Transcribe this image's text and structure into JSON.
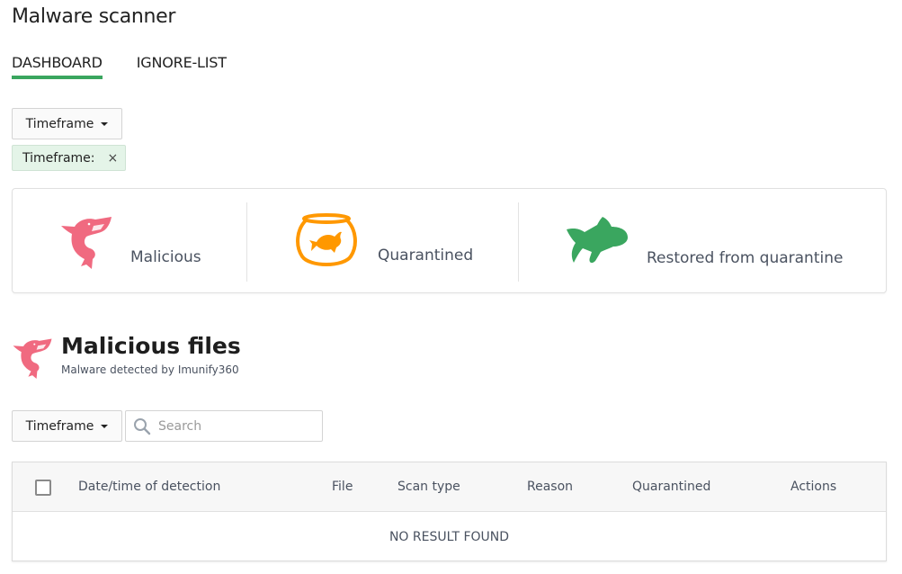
{
  "page": {
    "title": "Malware scanner"
  },
  "tabs": [
    {
      "label": "DASHBOARD",
      "active": true
    },
    {
      "label": "IGNORE-LIST",
      "active": false
    }
  ],
  "filters": {
    "timeframe_button": "Timeframe",
    "active_chip": {
      "label": "Timeframe:",
      "close_icon": "×"
    }
  },
  "stats": [
    {
      "label": "Malicious",
      "icon": "shark-icon",
      "color": "#f06a80"
    },
    {
      "label": "Quarantined",
      "icon": "fishbowl-icon",
      "color": "#ff9800"
    },
    {
      "label": "Restored from quarantine",
      "icon": "fish-icon",
      "color": "#3aa65f"
    }
  ],
  "section": {
    "title": "Malicious files",
    "subtitle": "Malware detected by Imunify360",
    "icon": "shark-icon"
  },
  "toolbar": {
    "timeframe_button": "Timeframe",
    "search_placeholder": "Search",
    "search_value": ""
  },
  "table": {
    "columns": [
      "Date/time of detection",
      "File",
      "Scan type",
      "Reason",
      "Quarantined",
      "Actions"
    ],
    "rows": [],
    "empty_message": "NO RESULT FOUND"
  },
  "colors": {
    "accent": "#3aa65f",
    "malicious": "#f06a80",
    "quarantined": "#ff9800",
    "restored": "#3aa65f"
  }
}
